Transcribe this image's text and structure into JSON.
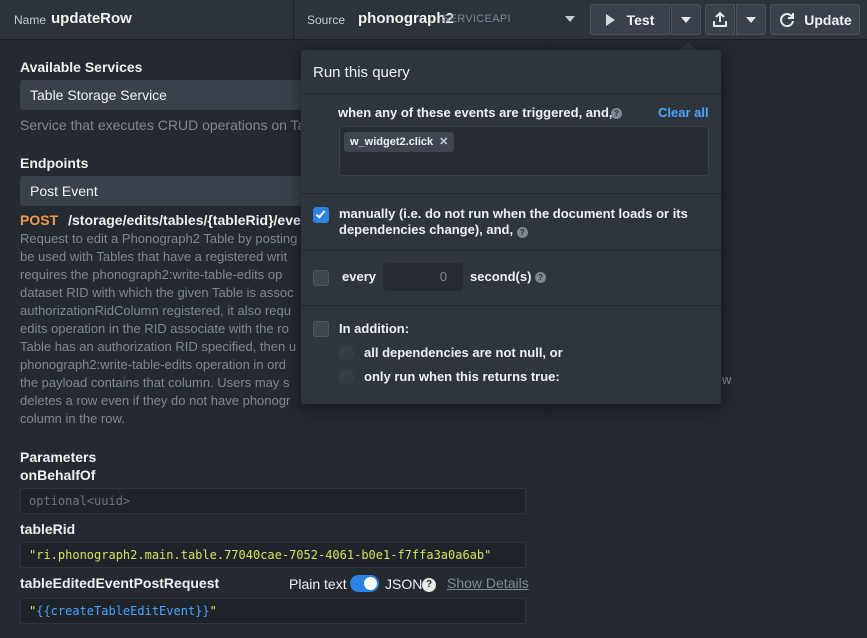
{
  "topbar": {
    "name_label": "Name",
    "name_value": "updateRow",
    "source_label": "Source",
    "source_value": "phonograph2",
    "source_type": "SERVICEAPI",
    "test_label": "Test",
    "update_label": "Update"
  },
  "services": {
    "heading": "Available Services",
    "selected": "Table Storage Service",
    "description": "Service that executes CRUD operations on Tabl"
  },
  "endpoints": {
    "heading": "Endpoints",
    "selected": "Post Event",
    "method": "POST",
    "path": "/storage/edits/tables/{tableRid}/events",
    "description_lines": [
      "Request to edit a Phonograph2 Table by posting",
      "be used with Tables that have a registered writ",
      "requires the phonograph2:write-table-edits op",
      "dataset RID with which the given Table is assoc",
      "authorizationRidColumn registered, it also requ",
      "edits operation in the RID associate with the ro",
      "Table has an authorization RID specified, then u",
      "phonograph2:write-table-edits operation in ord",
      "the payload contains that column. Users may s",
      "deletes a row even if they do not have phonogr",
      "column in the row."
    ]
  },
  "parameters": {
    "heading": "Parameters",
    "items": [
      {
        "name": "onBehalfOf",
        "value": "",
        "placeholder": "optional<uuid>"
      },
      {
        "name": "tableRid",
        "value": "\"ri.phonograph2.main.table.77040cae-7052-4061-b0e1-f7ffa3a0a6ab\""
      },
      {
        "name": "tableEditedEventPostRequest",
        "value_prefix": "\"",
        "value_template": "{{createTableEditEvent}}",
        "value_suffix": "\""
      }
    ],
    "plain_text_label": "Plain text",
    "json_label": "JSON",
    "json_mode_on": true,
    "show_details_label": "Show Details"
  },
  "right_panel": {
    "partial_text": "w"
  },
  "popover": {
    "title": "Run this query",
    "events_text": "when any of these events are triggered, and,",
    "clear_all_label": "Clear all",
    "event_tags": [
      "w_widget2.click"
    ],
    "manual_text": "manually (i.e. do not run when the document loads or its dependencies change), and,",
    "manual_checked": true,
    "every_label": "every",
    "every_value": "0",
    "seconds_label": "second(s)",
    "every_checked": false,
    "in_addition_label": "In addition:",
    "in_addition_checked": false,
    "options": [
      {
        "label": "all dependencies are not null, or"
      },
      {
        "label": "only run when this returns true:"
      }
    ]
  },
  "colors": {
    "accent": "#2b82e0",
    "link": "#4aa3ff",
    "method": "#f2994a",
    "string": "#d6e35a"
  }
}
